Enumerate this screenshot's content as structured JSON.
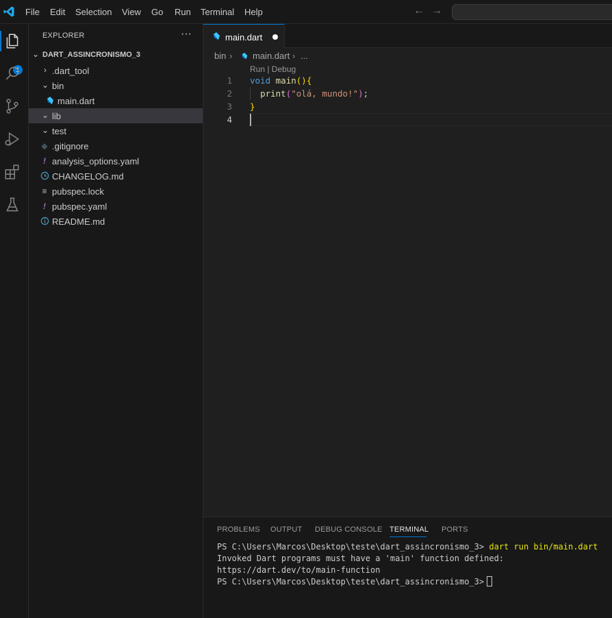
{
  "menu": {
    "items": [
      "File",
      "Edit",
      "Selection",
      "View",
      "Go",
      "Run",
      "Terminal",
      "Help"
    ]
  },
  "nav": {
    "back_icon": "arrow-left-icon",
    "forward_icon": "arrow-right-icon"
  },
  "activity_bar": {
    "icons": [
      "explorer-icon",
      "search-icon",
      "source-control-icon",
      "run-debug-icon",
      "extensions-icon",
      "testing-icon"
    ],
    "explorer_badge": "1"
  },
  "sidebar": {
    "title": "EXPLORER",
    "more_label": "···",
    "project_name": "DART_ASSINCRONISMO_3",
    "tree": [
      {
        "label": ".dart_tool",
        "type": "folder",
        "expanded": false
      },
      {
        "label": "bin",
        "type": "folder",
        "expanded": true
      },
      {
        "label": "main.dart",
        "type": "dart-file"
      },
      {
        "label": "lib",
        "type": "folder",
        "expanded": true,
        "selected": true
      },
      {
        "label": "test",
        "type": "folder",
        "expanded": true
      },
      {
        "label": ".gitignore",
        "type": "git-file"
      },
      {
        "label": "analysis_options.yaml",
        "type": "yaml-file"
      },
      {
        "label": "CHANGELOG.md",
        "type": "changelog-file"
      },
      {
        "label": "pubspec.lock",
        "type": "lock-file"
      },
      {
        "label": "pubspec.yaml",
        "type": "yaml-file"
      },
      {
        "label": "README.md",
        "type": "readme-file"
      }
    ]
  },
  "editor": {
    "tab_label": "main.dart",
    "breadcrumb": {
      "folder": "bin",
      "file": "main.dart",
      "more": "..."
    },
    "codelens": "Run | Debug",
    "line_numbers": [
      "1",
      "2",
      "3",
      "4"
    ],
    "code": {
      "l1_kw": "void",
      "l1_fn": "main",
      "l1_paren": "()",
      "l1_brace": "{",
      "l2_fn": "print",
      "l2_open": "(",
      "l2_str": "\"olá, mundo!\"",
      "l2_close": ")",
      "l2_semi": ";",
      "l3_brace": "}"
    }
  },
  "panel": {
    "tabs": [
      "PROBLEMS",
      "OUTPUT",
      "DEBUG CONSOLE",
      "TERMINAL",
      "PORTS"
    ],
    "active_tab": "TERMINAL",
    "terminal": {
      "prompt": "PS C:\\Users\\Marcos\\Desktop\\teste\\dart_assincronismo_3>",
      "command": "dart run bin/main.dart",
      "output_line_1": "Invoked Dart programs must have a 'main' function defined:",
      "output_line_2": "https://dart.dev/to/main-function",
      "prompt_2": "PS C:\\Users\\Marcos\\Desktop\\teste\\dart_assincronismo_3>"
    }
  },
  "colors": {
    "accent": "#0078d4",
    "background": "#1f1f1f",
    "sidebar": "#181818"
  }
}
